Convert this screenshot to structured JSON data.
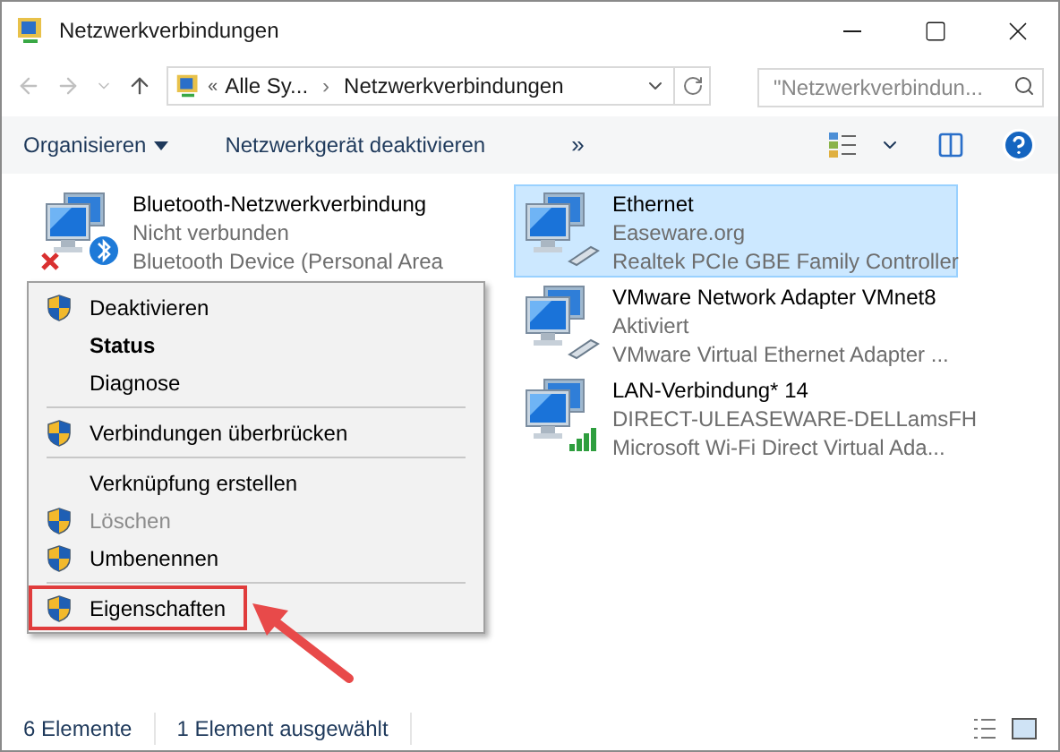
{
  "window": {
    "title": "Netzwerkverbindungen"
  },
  "address": {
    "prefix": "«",
    "crumbs": [
      "Alle Sy...",
      "Netzwerkverbindungen"
    ],
    "separator": "›"
  },
  "search": {
    "placeholder": "\"Netzwerkverbindun..."
  },
  "toolbar": {
    "items": [
      "Organisieren",
      "Netzwerkgerät deaktivieren"
    ],
    "overflow": "»"
  },
  "connections": [
    {
      "name": "Bluetooth-Netzwerkverbindung",
      "status": "Nicht verbunden",
      "device": "Bluetooth Device (Personal Area",
      "kind": "bluetooth",
      "disconnected": true,
      "selected": false
    },
    {
      "name": "Ethernet",
      "status": "Easeware.org",
      "device": "Realtek PCIe GBE Family Controller",
      "kind": "cable",
      "disconnected": false,
      "selected": true
    },
    {
      "name": "VMware Network Adapter VMnet8",
      "status": "Aktiviert",
      "device": "VMware Virtual Ethernet Adapter ...",
      "kind": "cable",
      "disconnected": false,
      "selected": false
    },
    {
      "name": "LAN-Verbindung* 14",
      "status": "DIRECT-ULEASEWARE-DELLamsFH",
      "device": "Microsoft Wi-Fi Direct Virtual Ada...",
      "kind": "signal",
      "disconnected": false,
      "selected": false
    }
  ],
  "context_menu": [
    {
      "kind": "item",
      "label": "Deaktivieren",
      "shield": true,
      "bold": false,
      "disabled": false,
      "highlighted": false
    },
    {
      "kind": "item",
      "label": "Status",
      "shield": false,
      "bold": true,
      "disabled": false,
      "highlighted": false
    },
    {
      "kind": "item",
      "label": "Diagnose",
      "shield": false,
      "bold": false,
      "disabled": false,
      "highlighted": false
    },
    {
      "kind": "separator"
    },
    {
      "kind": "item",
      "label": "Verbindungen überbrücken",
      "shield": true,
      "bold": false,
      "disabled": false,
      "highlighted": false
    },
    {
      "kind": "separator"
    },
    {
      "kind": "item",
      "label": "Verknüpfung erstellen",
      "shield": false,
      "bold": false,
      "disabled": false,
      "highlighted": false
    },
    {
      "kind": "item",
      "label": "Löschen",
      "shield": true,
      "bold": false,
      "disabled": true,
      "highlighted": false
    },
    {
      "kind": "item",
      "label": "Umbenennen",
      "shield": true,
      "bold": false,
      "disabled": false,
      "highlighted": false
    },
    {
      "kind": "separator"
    },
    {
      "kind": "item",
      "label": "Eigenschaften",
      "shield": true,
      "bold": false,
      "disabled": false,
      "highlighted": true
    }
  ],
  "status_bar": {
    "count": "6 Elemente",
    "selection": "1 Element ausgewählt"
  }
}
